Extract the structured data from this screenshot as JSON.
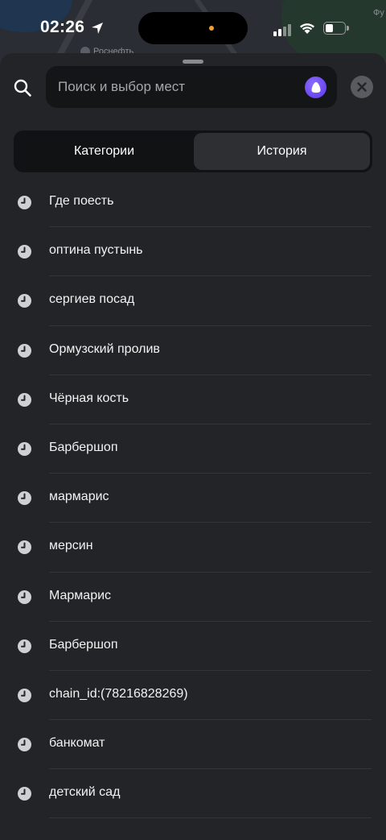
{
  "status_bar": {
    "time": "02:26"
  },
  "map": {
    "labels": [
      "Роснефть",
      "Фу"
    ]
  },
  "search": {
    "placeholder": "Поиск и выбор мест"
  },
  "tabs": [
    {
      "label": "Категории",
      "active": false
    },
    {
      "label": "История",
      "active": true
    }
  ],
  "history": [
    {
      "label": "Где поесть"
    },
    {
      "label": "оптина пустынь"
    },
    {
      "label": "сергиев посад"
    },
    {
      "label": "Ормузский пролив"
    },
    {
      "label": "Чёрная кость"
    },
    {
      "label": "Барбершоп"
    },
    {
      "label": "мармарис"
    },
    {
      "label": "мерсин"
    },
    {
      "label": "Мармарис"
    },
    {
      "label": "Барбершоп"
    },
    {
      "label": "chain_id:(78216828269)"
    },
    {
      "label": "банкомат"
    },
    {
      "label": "детский сад"
    }
  ],
  "icons": {
    "history_item": "clock-icon",
    "search": "search-icon",
    "assistant": "alice-icon",
    "close": "close-icon"
  },
  "colors": {
    "background": "#232428",
    "search_field": "#141517",
    "assistant_accent": "#6b4cf6"
  }
}
